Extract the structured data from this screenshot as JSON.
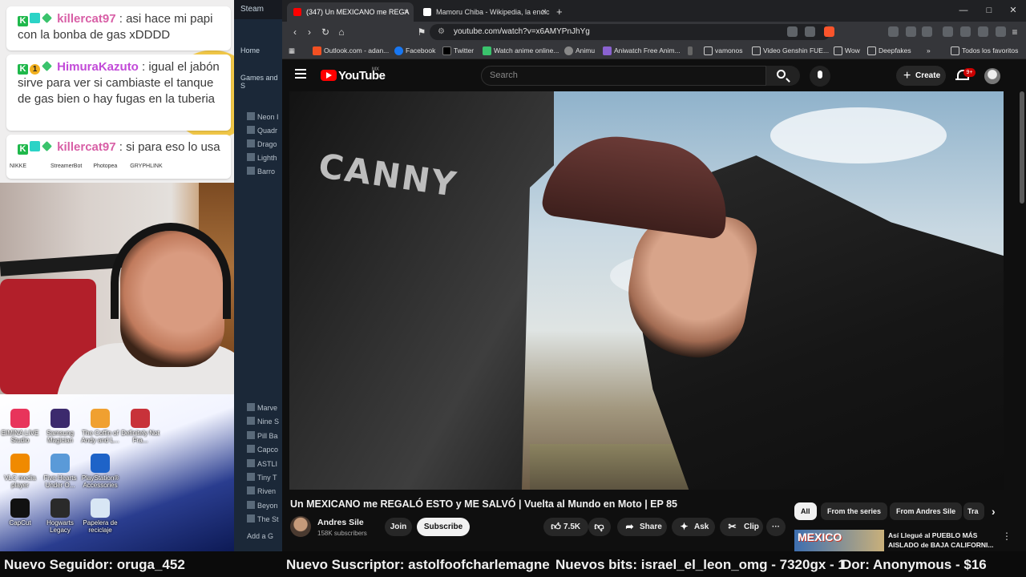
{
  "chat": {
    "messages": [
      {
        "user": "killercat97",
        "text": ": asi hace mi papi con la bonba de gas xDDDD"
      },
      {
        "user": "HimuraKazuto",
        "text": ": igual el jabón sirve para ver si cambiaste el tanque de gas bien o hay fugas en la tuberia"
      },
      {
        "user": "killercat97",
        "text": ": si para eso lo usa"
      }
    ]
  },
  "desktop": {
    "icons_row_top": [
      "NIKKE",
      "StreamerBot",
      "Photopea",
      "GRYPHLINK"
    ],
    "icons": [
      {
        "label": "EIMINA LIVE Studio",
        "color": "#e8345b"
      },
      {
        "label": "Samsung Magician",
        "color": "#3c2a6d"
      },
      {
        "label": "The Coffin of Andy and L...",
        "color": "#f0a030"
      },
      {
        "label": "Definitely Not Fra...",
        "color": "#c8323a"
      },
      {
        "label": "VLC media player",
        "color": "#f08a00"
      },
      {
        "label": "Five Hearts Under O...",
        "color": "#5a9ad8"
      },
      {
        "label": "PlayStation® Accessories",
        "color": "#1e63c8"
      },
      {
        "label": "CapCut",
        "color": "#111111"
      },
      {
        "label": "Hogwarts Legacy",
        "color": "#2a2a2a"
      },
      {
        "label": "Papelera de reciclaje",
        "color": "#d8e6f4"
      }
    ]
  },
  "steam": {
    "title": "Steam",
    "home": "Home",
    "section": "Games and S",
    "games_top": [
      "Neon I",
      "Quadr",
      "Drago",
      "Lighth",
      "Barro"
    ],
    "games_bottom": [
      "Marve",
      "Nine S",
      "Pill Ba",
      "Capco",
      "ASTLI",
      "Tiny T",
      "Riven",
      "Beyon",
      "The St"
    ],
    "add_game": "Add a G"
  },
  "browser": {
    "tabs": [
      {
        "label": "(347) Un MEXICANO me REGA",
        "active": true
      },
      {
        "label": "Mamoru Chiba - Wikipedia, la encic",
        "active": false
      }
    ],
    "new_tab": "+",
    "url": "youtube.com/watch?v=x6AMYPnJhYg",
    "bookmarks": [
      "Outlook.com - adan...",
      "Facebook",
      "Twitter",
      "Watch anime online...",
      "Animu",
      "Aniwatch Free Anim...",
      "vamonos",
      "Video Genshin FUE...",
      "Wow",
      "Deepfakes"
    ],
    "bookmarks_more": "»",
    "all_bookmarks": "Todos los favoritos"
  },
  "youtube": {
    "logo": "YouTube",
    "country": "MX",
    "search_placeholder": "Search",
    "create_label": "Create",
    "notifications": "9+",
    "video_overlay_text": "CANNY",
    "video_title": "Un MEXICANO me REGALÓ ESTO y ME SALVÓ | Vuelta al Mundo en Moto | EP 85",
    "channel_name": "Andres Sile",
    "subscribers": "158K subscribers",
    "join_label": "Join",
    "subscribe_label": "Subscribe",
    "likes": "7.5K",
    "share_label": "Share",
    "ask_label": "Ask",
    "clip_label": "Clip",
    "chips": [
      "All",
      "From the series",
      "From Andres Sile",
      "Tra"
    ],
    "suggested": {
      "thumb_text": "MEXICO",
      "title": "Así Llegué al PUEBLO MÁS AISLADO de BAJA CALIFORNI..."
    }
  },
  "ticker": {
    "items": [
      "Nuevo Seguidor: oruga_452",
      "Nuevo Suscriptor: astolfoofcharlemagne",
      "Nuevos bits: israel_el_leon_omg - 7320gx - 1",
      "Dor: Anonymous - $16"
    ]
  }
}
